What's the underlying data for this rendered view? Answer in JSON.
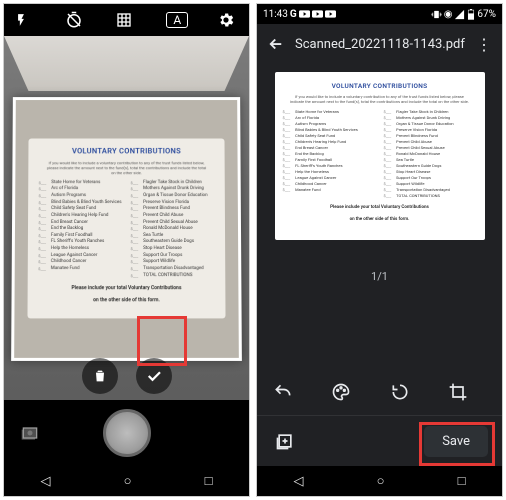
{
  "left": {
    "cam_top": {
      "flash": "flash-icon",
      "timer": "timer-off-icon",
      "grid": "grid-icon",
      "auto": "A",
      "settings": "settings-icon"
    },
    "actions": {
      "delete": "trash-icon",
      "confirm": "check-icon"
    }
  },
  "right": {
    "status": {
      "time": "11:43",
      "g": "G",
      "battery": "67%"
    },
    "appbar": {
      "title": "Scanned_20221118-1143.pdf"
    },
    "page_indicator": "1/1",
    "save_label": "Save"
  },
  "doc": {
    "title": "VOLUNTARY CONTRIBUTIONS",
    "sub": "If you would like to include a voluntary contribution to any of the trust funds listed below, please indicate the amount next to the fund(s), total the contributions and include the total on the other side.",
    "left_col": [
      "State Home for Veterans",
      "Arc of Florida",
      "Autism Programs",
      "Blind Babies & Blind Youth Services",
      "Child Safety Seat Fund",
      "Children's Hearing Help Fund",
      "End Breast Cancer",
      "End the Backlog",
      "Family First Foodhall",
      "FL Sheriff's Youth Ranches",
      "Help the Homeless",
      "League Against Cancer",
      "Childhood Cancer",
      "Manatee Fund"
    ],
    "right_col": [
      "Flagler Take Stock in Children",
      "Mothers Against Drunk Driving",
      "Organ & Tissue Donor Education",
      "Preserve Vision Florida",
      "Prevent Blindness Fund",
      "Prevent Child Abuse",
      "Prevent Child Sexual Abuse",
      "Ronald McDonald House",
      "Sea Turtle",
      "Southeastern Guide Dogs",
      "Stop Heart Disease",
      "Support Our Troops",
      "Support Wildlife",
      "Transportation Disadvantaged",
      "TOTAL CONTRIBUTIONS"
    ],
    "footer1": "Please include your total Voluntary Contributions",
    "footer2": "on the other side of this form."
  },
  "nav": {
    "back": "◁",
    "home": "○",
    "recent": "□"
  }
}
